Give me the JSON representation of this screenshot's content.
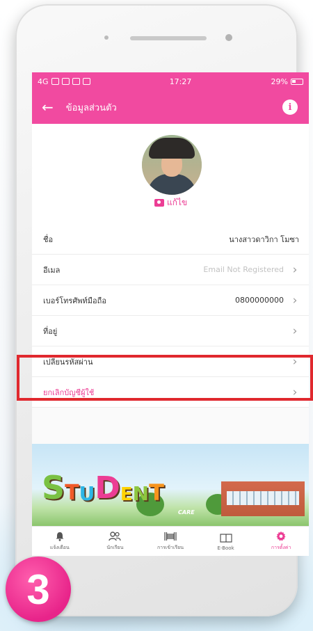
{
  "statusbar": {
    "network": "4G",
    "time": "17:27",
    "right": "29%"
  },
  "header": {
    "title": "ข้อมูลส่วนตัว",
    "info_icon": "i"
  },
  "profile": {
    "edit_label": "แก้ไข"
  },
  "fields": [
    {
      "label": "ชื่อ",
      "value": "นางสาวดาวิกา โมซา",
      "muted": false,
      "chevron": false
    },
    {
      "label": "อีเมล",
      "value": "Email Not Registered",
      "muted": true,
      "chevron": true
    },
    {
      "label": "เบอร์โทรศัพท์มือถือ",
      "value": "0800000000",
      "muted": false,
      "chevron": true
    },
    {
      "label": "ที่อยู่",
      "value": "",
      "muted": false,
      "chevron": true
    },
    {
      "label": "เปลี่ยนรหัสผ่าน",
      "value": "",
      "muted": false,
      "chevron": true
    },
    {
      "label": "ยกเลิกบัญชีผู้ใช้",
      "value": "",
      "muted": false,
      "chevron": true
    }
  ],
  "banner": {
    "logo_letters": [
      "S",
      "T",
      "U",
      "D",
      "E",
      "N",
      "T"
    ],
    "logo_tag": "CARE",
    "letter_colors": [
      "#7ac143",
      "#f15a29",
      "#2bb6e6",
      "#ec3d94",
      "#ffd200",
      "#8dc63f",
      "#f7941d"
    ]
  },
  "tabs": [
    {
      "label": "แจ้งเตือน",
      "icon": "bell-icon",
      "active": false
    },
    {
      "label": "นักเรียน",
      "icon": "students-icon",
      "active": false
    },
    {
      "label": "การเข้าเรียน",
      "icon": "barcode-icon",
      "active": false
    },
    {
      "label": "E-Book",
      "icon": "book-icon",
      "active": false
    },
    {
      "label": "การตั้งค่า",
      "icon": "gear-icon",
      "active": true
    }
  ],
  "step_badge": "3",
  "colors": {
    "accent": "#f14aa0",
    "pink_text": "#ec3d94",
    "highlight": "#e0282e"
  }
}
